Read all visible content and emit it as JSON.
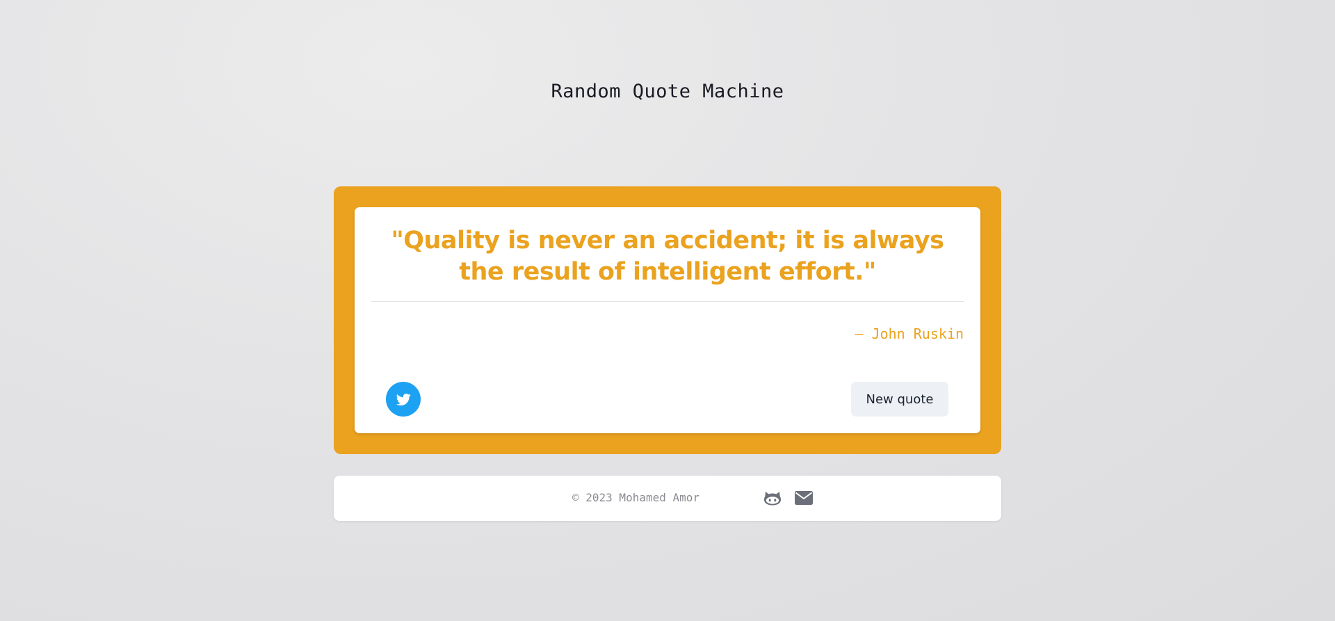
{
  "header": {
    "title": "Random Quote Machine"
  },
  "quote": {
    "text": "\"Quality is never an accident; it is always the result of intelligent effort.\"",
    "author": "— John Ruskin"
  },
  "actions": {
    "tweet_icon": "twitter-icon",
    "new_quote_label": "New quote"
  },
  "footer": {
    "copyright": "© 2023 Mohamed Amor",
    "icons": [
      "github-icon",
      "envelope-icon"
    ]
  },
  "colors": {
    "accent": "#eaa21f",
    "twitter": "#1da1f2",
    "background": "#e4e4e6",
    "icon_gray": "#6b6f7a"
  }
}
